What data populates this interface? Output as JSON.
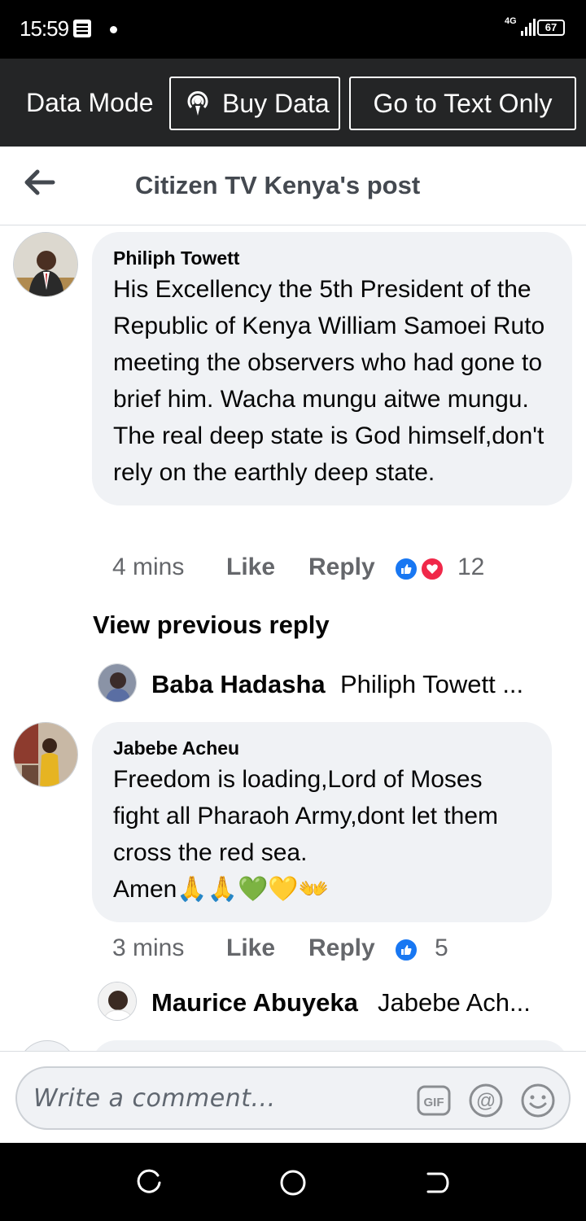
{
  "status_bar": {
    "time": "15:59",
    "network": "4G",
    "battery": "67"
  },
  "data_mode": {
    "label": "Data Mode",
    "buy_data": "Buy Data",
    "text_only": "Go to Text Only"
  },
  "header": {
    "title": "Citizen TV Kenya's post"
  },
  "comments": [
    {
      "author": "Philiph Towett",
      "text": "His Excellency the 5th President of the Republic of Kenya William Samoei Ruto meeting the observers who had gone to brief him. Wacha mungu aitwe mungu.  The real deep state is God himself,don't rely on the earthly deep state.",
      "time": "4 mins",
      "like": "Like",
      "reply": "Reply",
      "reactions": "12"
    },
    {
      "author": "Jabebe Acheu",
      "text": "Freedom is loading,Lord of Moses fight all Pharaoh Army,dont let them cross the red sea.\nAmen🙏🙏💚💛👐",
      "time": "3 mins",
      "like": "Like",
      "reply": "Reply",
      "reactions": "5"
    }
  ],
  "view_previous": "View previous reply",
  "replies": [
    {
      "name": "Baba Hadasha",
      "text": "Philiph Towett ..."
    },
    {
      "name": "Maurice Abuyeka",
      "text": "Jabebe Ach..."
    }
  ],
  "composer": {
    "placeholder": "Write a comment..."
  },
  "colors": {
    "like_blue": "#1877f2",
    "love_red": "#f02849",
    "bubble_bg": "#f0f2f5",
    "topbar_bg": "#242526"
  }
}
